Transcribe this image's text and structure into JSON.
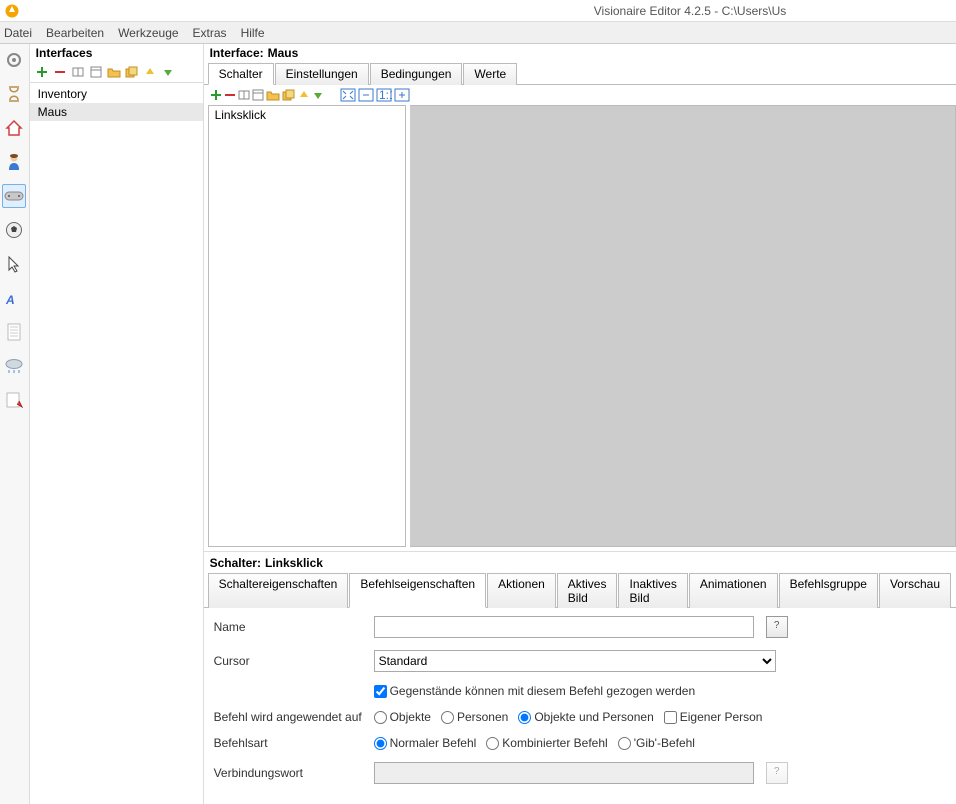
{
  "window": {
    "title": "Visionaire Editor 4.2.5 - C:\\Users\\Us"
  },
  "menu": {
    "file": "Datei",
    "edit": "Bearbeiten",
    "tools": "Werkzeuge",
    "extras": "Extras",
    "help": "Hilfe"
  },
  "left_panel": {
    "title": "Interfaces",
    "items": [
      "Inventory",
      "Maus"
    ],
    "selected": 1
  },
  "right": {
    "header_label": "Interface:",
    "header_value": "Maus",
    "tabs": [
      "Schalter",
      "Einstellungen",
      "Bedingungen",
      "Werte"
    ],
    "active_tab": 0,
    "list": [
      "Linksklick"
    ]
  },
  "schalter": {
    "header_label": "Schalter:",
    "header_value": "Linksklick",
    "tabs": [
      "Schaltereigenschaften",
      "Befehlseigenschaften",
      "Aktionen",
      "Aktives Bild",
      "Inaktives Bild",
      "Animationen",
      "Befehlsgruppe",
      "Vorschau"
    ],
    "active_tab": 1
  },
  "form": {
    "name_label": "Name",
    "name_value": "",
    "cursor_label": "Cursor",
    "cursor_value": "Standard",
    "drag_label": "Gegenstände können mit diesem Befehl gezogen werden",
    "drag_checked": true,
    "applies_label": "Befehl wird angewendet auf",
    "applies_options": [
      "Objekte",
      "Personen",
      "Objekte und Personen"
    ],
    "applies_selected": 2,
    "applies_own_label": "Eigener Person",
    "applies_own_checked": false,
    "type_label": "Befehlsart",
    "type_options": [
      "Normaler Befehl",
      "Kombinierter Befehl",
      "'Gib'-Befehl"
    ],
    "type_selected": 0,
    "conj_label": "Verbindungswort",
    "conj_value": "",
    "qmark": "?"
  }
}
